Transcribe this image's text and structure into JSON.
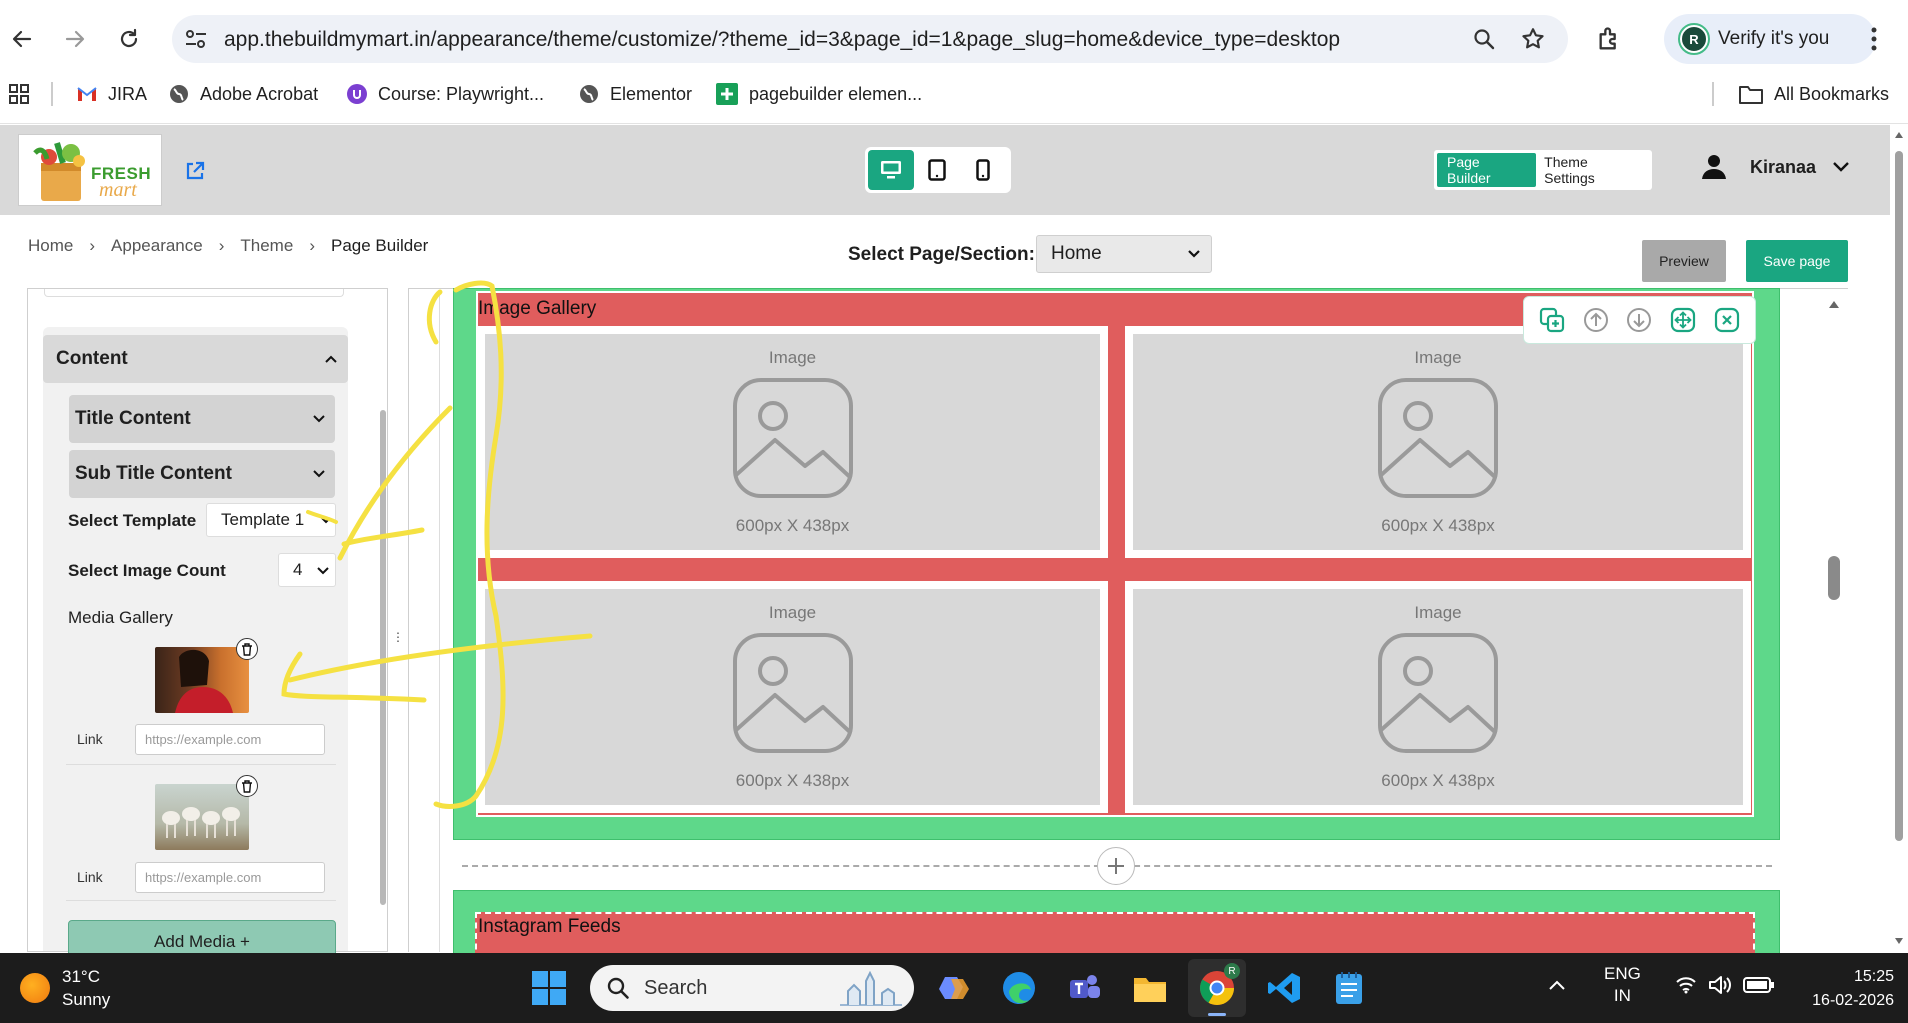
{
  "browser": {
    "url": "app.thebuildmymart.in/appearance/theme/customize/?theme_id=3&page_id=1&page_slug=home&device_type=desktop",
    "profile_label": "Verify it's you",
    "profile_initial": "R",
    "bookmarks": [
      "JIRA",
      "Adobe Acrobat",
      "Course: Playwright...",
      "Elementor",
      "pagebuilder elemen..."
    ],
    "all_bookmarks": "All Bookmarks"
  },
  "app": {
    "logo_line1": "FRESH",
    "logo_line2": "mart",
    "mode_page_builder": "Page Builder",
    "mode_theme_settings": "Theme Settings",
    "user_name": "Kiranaa",
    "devices": [
      "desktop-icon",
      "tablet-icon",
      "mobile-icon"
    ],
    "accent_color": "#1aa681"
  },
  "breadcrumb": [
    "Home",
    "Appearance",
    "Theme",
    "Page Builder"
  ],
  "toolbar": {
    "select_page_label": "Select Page/Section:",
    "select_page_value": "Home",
    "preview_label": "Preview",
    "save_label": "Save page"
  },
  "left_panel": {
    "content_title": "Content",
    "title_content": "Title Content",
    "sub_title_content": "Sub Title Content",
    "select_template_label": "Select Template",
    "select_template_value": "Template 1",
    "image_count_label": "Select Image Count",
    "image_count_value": "4",
    "media_gallery_label": "Media Gallery",
    "media_items": [
      {
        "link_label": "Link",
        "link_placeholder": "https://example.com"
      },
      {
        "link_label": "Link",
        "link_placeholder": "https://example.com"
      }
    ],
    "add_media_label": "Add Media +"
  },
  "canvas": {
    "gallery_title": "Image Gallery",
    "tiles": [
      {
        "label": "Image",
        "size": "600px X 438px"
      },
      {
        "label": "Image",
        "size": "600px X 438px"
      },
      {
        "label": "Image",
        "size": "600px X 438px"
      },
      {
        "label": "Image",
        "size": "600px X 438px"
      }
    ],
    "section_tools": [
      "duplicate-icon",
      "move-up-icon",
      "move-down-icon",
      "drag-move-icon",
      "close-icon"
    ],
    "next_section_title": "Instagram Feeds",
    "section_bg_color": "#5ed88a",
    "section_inner_color": "#e05d5d"
  },
  "taskbar": {
    "temperature": "31°C",
    "weather": "Sunny",
    "search_placeholder": "Search",
    "lang_line1": "ENG",
    "lang_line2": "IN",
    "time": "15:25",
    "date": "16-02-2026"
  }
}
